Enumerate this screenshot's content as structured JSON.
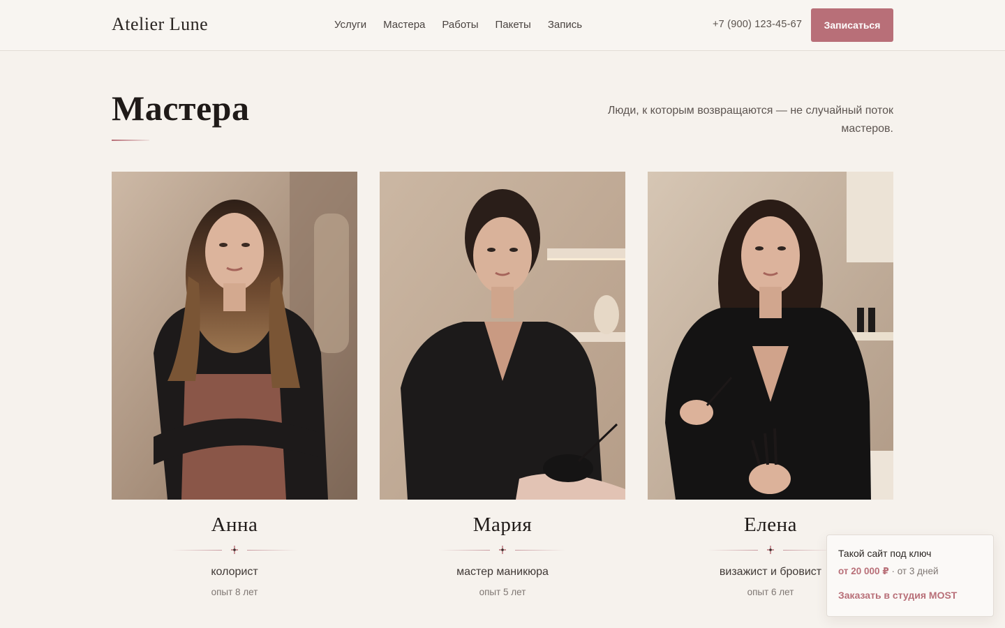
{
  "header": {
    "logo": "Atelier Lune",
    "nav": [
      {
        "label": "Услуги"
      },
      {
        "label": "Мастера"
      },
      {
        "label": "Работы"
      },
      {
        "label": "Пакеты"
      },
      {
        "label": "Запись"
      }
    ],
    "phone": "+7 (900) 123-45-67",
    "cta_label": "Записаться"
  },
  "section": {
    "title": "Мастера",
    "subtitle": "Люди, к которым возвращаются — не случайный поток мастеров."
  },
  "masters": [
    {
      "name": "Анна",
      "role": "колорист",
      "experience": "опыт 8 лет"
    },
    {
      "name": "Мария",
      "role": "мастер маникюра",
      "experience": "опыт 5 лет"
    },
    {
      "name": "Елена",
      "role": "визажист и бровист",
      "experience": "опыт 6 лет"
    }
  ],
  "promo": {
    "title": "Такой сайт под ключ",
    "price": "от 20 000 ₽",
    "term": " · от 3 дней",
    "link": "Заказать в студия MOST"
  },
  "colors": {
    "accent": "#b86f78",
    "background": "#f6f2ed",
    "text": "#2a2522"
  }
}
